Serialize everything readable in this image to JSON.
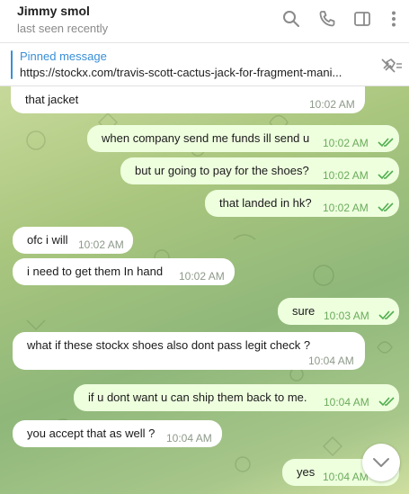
{
  "header": {
    "name": "Jimmy smol",
    "status": "last seen recently",
    "icons": [
      "search-icon",
      "phone-icon",
      "sidebar-icon",
      "more-icon"
    ]
  },
  "pinned": {
    "title": "Pinned message",
    "text": "https://stockx.com/travis-scott-cactus-jack-for-fragment-mani..."
  },
  "messages": [
    {
      "dir": "in",
      "text": "that jacket",
      "time": "10:02 AM"
    },
    {
      "dir": "out",
      "text": "when company send me funds ill send u",
      "time": "10:02 AM"
    },
    {
      "dir": "out",
      "text": "but ur going to pay for the shoes?",
      "time": "10:02 AM"
    },
    {
      "dir": "out",
      "text": "that landed in hk?",
      "time": "10:02 AM"
    },
    {
      "dir": "in",
      "text": "ofc i will",
      "time": "10:02 AM"
    },
    {
      "dir": "in",
      "text": "i need to get them In hand",
      "time": "10:02 AM"
    },
    {
      "dir": "out",
      "text": "sure",
      "time": "10:03 AM"
    },
    {
      "dir": "in",
      "text": "what if these stockx shoes also dont pass legit check ?",
      "time": "10:04 AM"
    },
    {
      "dir": "out",
      "text": "if u dont want u can ship them back to me.",
      "time": "10:04 AM"
    },
    {
      "dir": "in",
      "text": "you accept that as well ?",
      "time": "10:04 AM"
    },
    {
      "dir": "out",
      "text": "yes",
      "time": "10:04 AM"
    }
  ],
  "colors": {
    "accent": "#3a8fd6",
    "incoming_bubble": "#ffffff",
    "outgoing_bubble": "#eeffde",
    "read_check": "#4fae4e"
  }
}
